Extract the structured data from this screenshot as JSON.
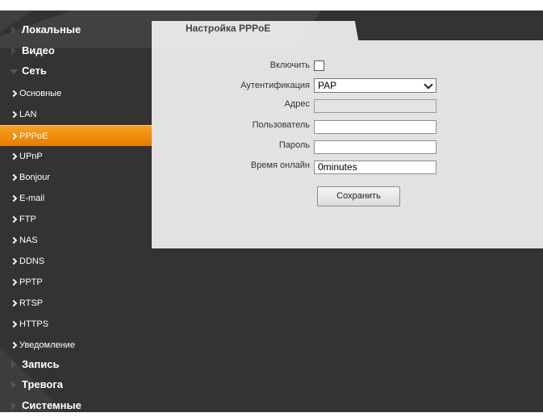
{
  "sidebar": {
    "items": [
      {
        "label": "Локальные",
        "kind": "top"
      },
      {
        "label": "Видео",
        "kind": "top"
      },
      {
        "label": "Сеть",
        "kind": "top-open"
      },
      {
        "label": "Основные",
        "kind": "sub"
      },
      {
        "label": "LAN",
        "kind": "sub"
      },
      {
        "label": "PPPoE",
        "kind": "sub-active"
      },
      {
        "label": "UPnP",
        "kind": "sub"
      },
      {
        "label": "Bonjour",
        "kind": "sub"
      },
      {
        "label": "E-mail",
        "kind": "sub"
      },
      {
        "label": "FTP",
        "kind": "sub"
      },
      {
        "label": "NAS",
        "kind": "sub"
      },
      {
        "label": "DDNS",
        "kind": "sub"
      },
      {
        "label": "PPTP",
        "kind": "sub"
      },
      {
        "label": "RTSP",
        "kind": "sub"
      },
      {
        "label": "HTTPS",
        "kind": "sub"
      },
      {
        "label": "Уведомление",
        "kind": "sub"
      },
      {
        "label": "Запись",
        "kind": "top"
      },
      {
        "label": "Тревога",
        "kind": "top"
      },
      {
        "label": "Системные",
        "kind": "top"
      }
    ]
  },
  "tab": {
    "label": "Настройка PPPoE"
  },
  "form": {
    "enable_label": "Включить",
    "enable_checked": false,
    "auth_label": "Аутентификация",
    "auth_value": "PAP",
    "address_label": "Адрес",
    "address_value": "",
    "user_label": "Пользователь",
    "user_value": "",
    "password_label": "Пароль",
    "password_value": "",
    "online_label": "Время онлайн",
    "online_value": "0minutes",
    "save_label": "Сохранить"
  },
  "colors": {
    "background": "#333333",
    "panel": "#e2e2e2",
    "accent": "#f39c12"
  }
}
